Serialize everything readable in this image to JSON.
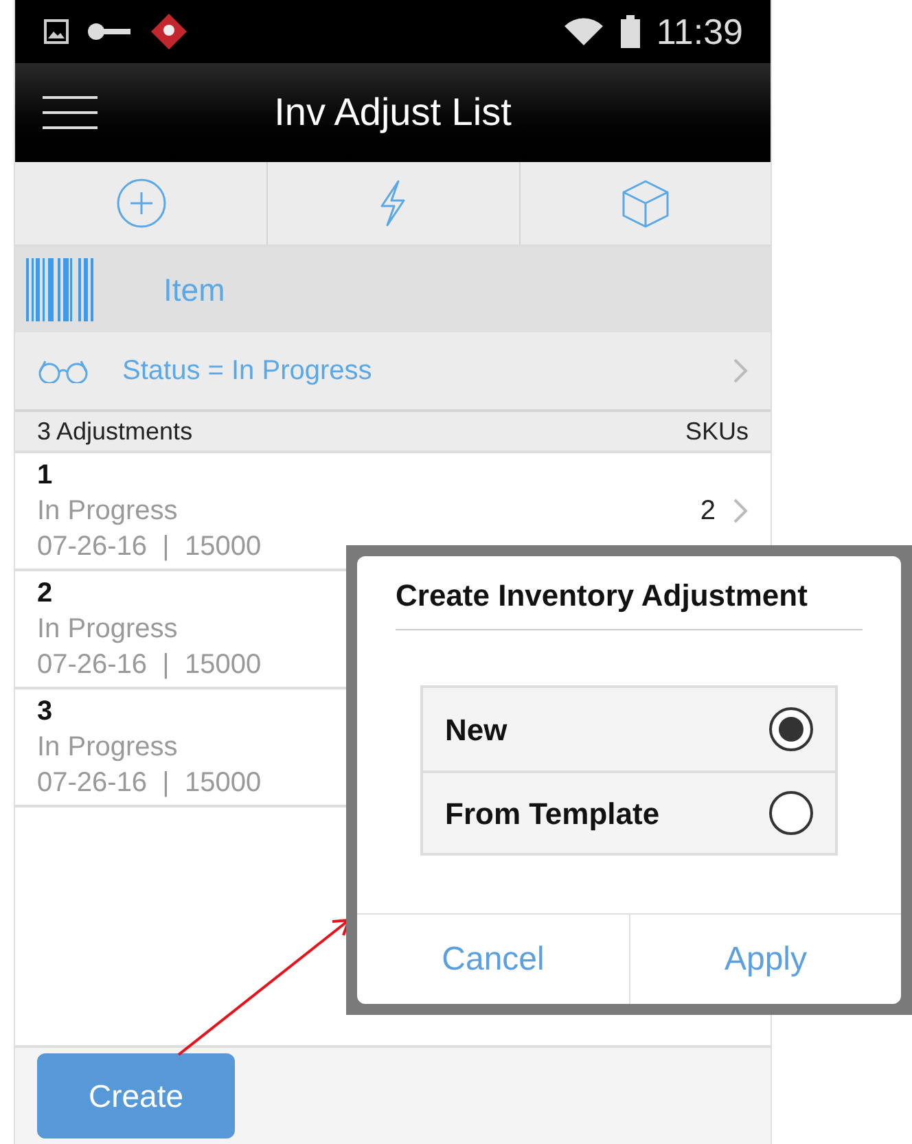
{
  "status_bar": {
    "time": "11:39"
  },
  "header": {
    "title": "Inv Adjust List"
  },
  "toolbar": [
    {
      "kind": "add"
    },
    {
      "kind": "bolt"
    },
    {
      "kind": "box"
    }
  ],
  "scan_bar": {
    "label": "Item"
  },
  "filter": {
    "label": "Status = In Progress"
  },
  "list_header": {
    "count": "3 Adjustments",
    "column": "SKUs"
  },
  "rows": [
    {
      "id": "1",
      "status": "In Progress",
      "details": "07-26-16  |  15000",
      "skus": "2"
    },
    {
      "id": "2",
      "status": "In Progress",
      "details": "07-26-16  |  15000"
    },
    {
      "id": "3",
      "status": "In Progress",
      "details": "07-26-16  |  15000"
    }
  ],
  "footer": {
    "button": "Create"
  },
  "dialog": {
    "title": "Create Inventory Adjustment",
    "options": [
      {
        "label": "New",
        "selected": true
      },
      {
        "label": "From Template",
        "selected": false
      }
    ],
    "buttons": [
      "Cancel",
      "Apply"
    ]
  }
}
